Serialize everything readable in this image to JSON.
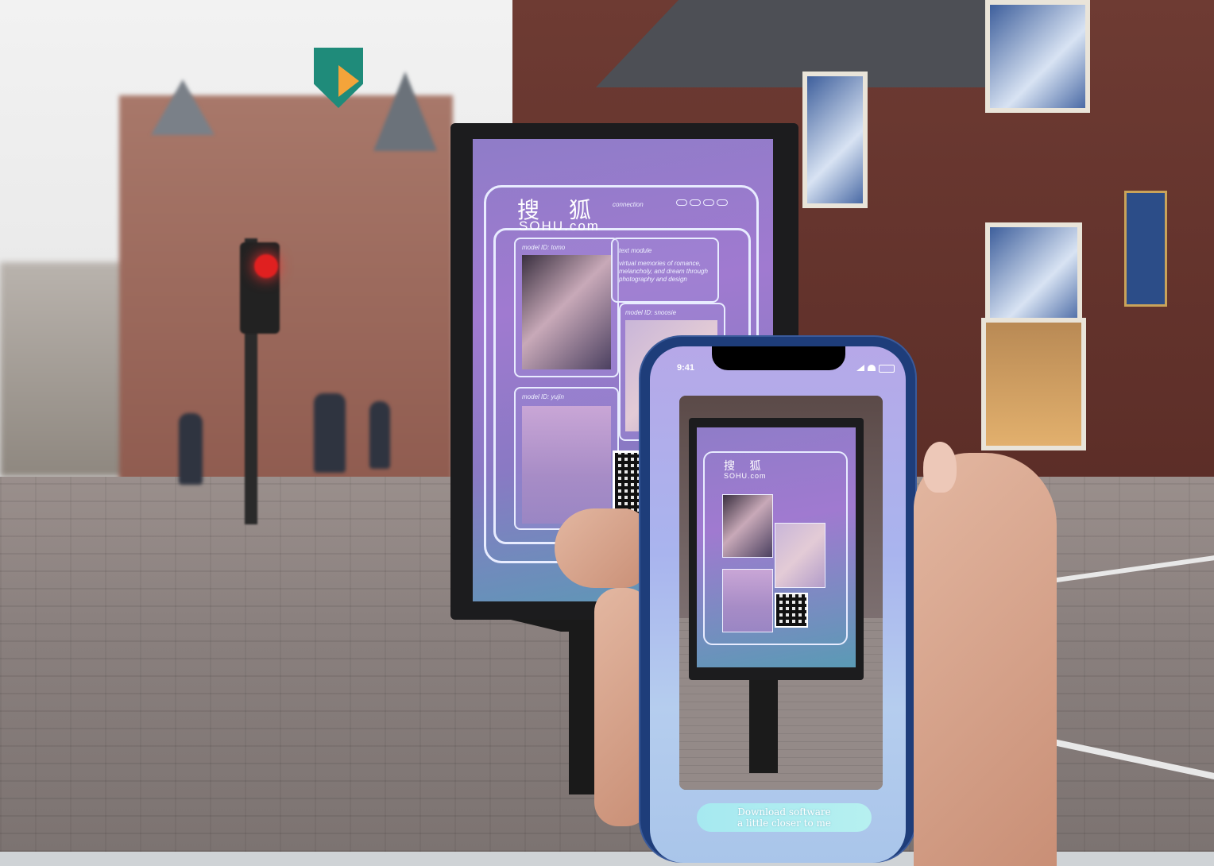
{
  "poster": {
    "logo_cn": "搜 狐",
    "logo_en": "SOHU.com",
    "connection_label": "connection",
    "text_module_label": "text module",
    "text_module_body": "virtual memories of romance, melancholy, and dream through photography and design",
    "model_1": "model ID: tomo",
    "model_2": "model ID: snoosie",
    "model_3": "model ID: yujin"
  },
  "phone": {
    "status_time": "9:41",
    "button_line_1": "Download software",
    "button_line_2": "a little closer to me"
  },
  "colors": {
    "poster_purple": "#9a7ccd",
    "phone_frame": "#1e3d7a",
    "button_cyan": "#a6e9f0",
    "traffic_red": "#e02020"
  }
}
